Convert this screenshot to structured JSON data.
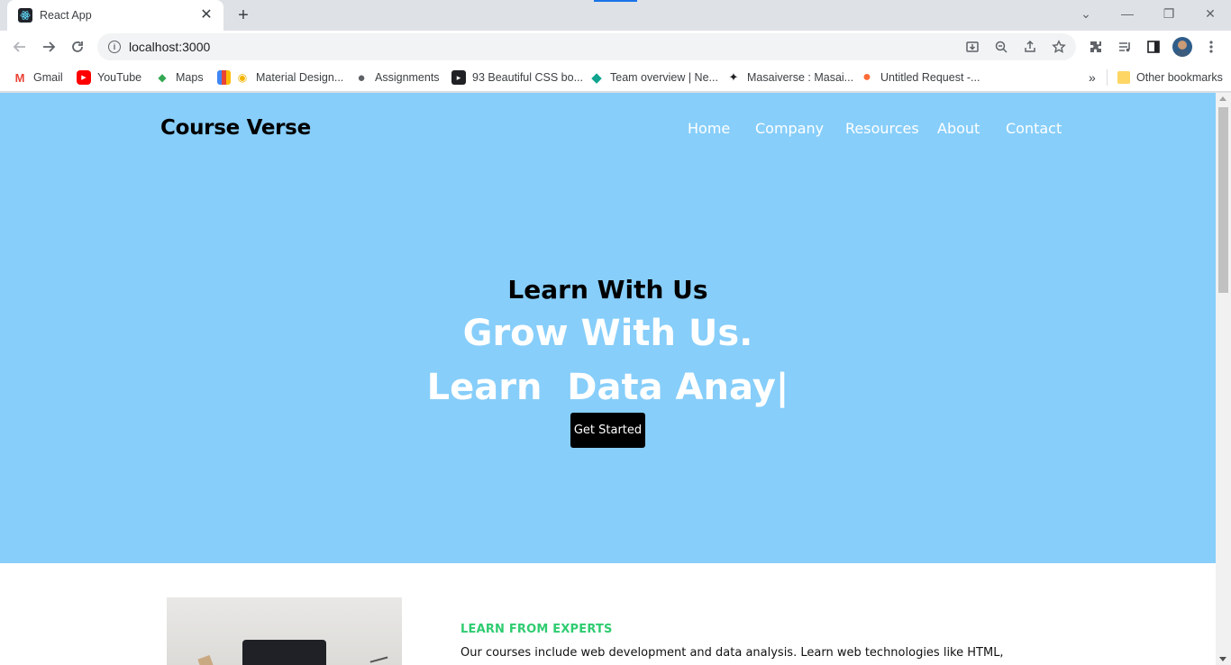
{
  "browser": {
    "tab": {
      "title": "React App",
      "close_glyph": "✕",
      "favicon": "react-icon"
    },
    "new_tab_glyph": "+",
    "window_controls": {
      "dropdown": "⌄",
      "minimize": "—",
      "restore": "❐",
      "close": "✕"
    },
    "address": {
      "url": "localhost:3000",
      "info_glyph": "i"
    },
    "bookmarks": [
      {
        "label": "Gmail",
        "icon": "gmail-icon",
        "glyph": "M",
        "color": "#ea4335"
      },
      {
        "label": "YouTube",
        "icon": "youtube-icon",
        "glyph": "▶",
        "color": "#ff0000"
      },
      {
        "label": "Maps",
        "icon": "maps-icon",
        "glyph": "◆",
        "color": "#34a853"
      },
      {
        "label": "Material Design...",
        "icon": "material-design-icon",
        "glyph": "◉",
        "color": "#f4b400"
      },
      {
        "label": "Assignments",
        "icon": "globe-icon",
        "glyph": "●",
        "color": "#5f6368"
      },
      {
        "label": "93 Beautiful CSS bo...",
        "icon": "css-icon",
        "glyph": "▸",
        "color": "#202124"
      },
      {
        "label": "Team overview | Ne...",
        "icon": "diamond-icon",
        "glyph": "◆",
        "color": "#10a38f"
      },
      {
        "label": "Masaiverse : Masai...",
        "icon": "sparkle-icon",
        "glyph": "✦",
        "color": "#202124"
      },
      {
        "label": "Untitled Request -...",
        "icon": "postman-icon",
        "glyph": "●",
        "color": "#ff6c37"
      }
    ],
    "bookmarks_overflow": "»",
    "other_bookmarks": "Other bookmarks"
  },
  "site": {
    "brand": "Course Verse",
    "nav": [
      "Home",
      "Company",
      "Resources",
      "About",
      "Contact"
    ],
    "hero": {
      "line1": "Learn With Us",
      "line2": "Grow With Us.",
      "typed": "Learn  Data Anay|",
      "cta": "Get Started"
    },
    "about": {
      "kicker": "LEARN FROM EXPERTS",
      "text": "Our courses include web development and data analysis. Learn web technologies like HTML,"
    }
  },
  "colors": {
    "hero_bg": "#87cefa",
    "kicker": "#2ecc71",
    "cta_bg": "#000000"
  }
}
